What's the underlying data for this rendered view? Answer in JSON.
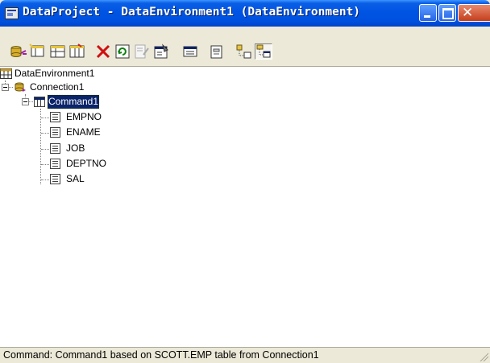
{
  "window": {
    "title": "DataProject - DataEnvironment1 (DataEnvironment)"
  },
  "toolbar": {
    "buttons": [
      {
        "name": "add-connection-button",
        "icon": "connection-icon"
      },
      {
        "name": "add-command-button",
        "icon": "command-icon"
      },
      {
        "name": "add-child-command-button",
        "icon": "child-command-icon"
      },
      {
        "name": "insert-stored-procedures-button",
        "icon": "stored-procedure-icon"
      },
      {
        "name": "delete-button",
        "icon": "delete-icon"
      },
      {
        "name": "refresh-button",
        "icon": "refresh-icon"
      },
      {
        "name": "view-code-button",
        "icon": "code-icon"
      },
      {
        "name": "properties-button",
        "icon": "properties-icon"
      },
      {
        "name": "options-button",
        "icon": "options-icon"
      },
      {
        "name": "design-button",
        "icon": "design-icon"
      },
      {
        "name": "arrange-by-connections-button",
        "icon": "arrange-connections-icon"
      },
      {
        "name": "arrange-by-objects-button",
        "icon": "arrange-objects-icon"
      }
    ]
  },
  "tree": {
    "root_label": "DataEnvironment1",
    "connection_label": "Connection1",
    "command_label": "Command1",
    "fields": [
      "EMPNO",
      "ENAME",
      "JOB",
      "DEPTNO",
      "SAL"
    ]
  },
  "status": {
    "text": "Command:  Command1 based on SCOTT.EMP  table  from Connection1"
  },
  "colors": {
    "titlebar": "#0054e3",
    "selection": "#0a246a",
    "close_button": "#c43e1c"
  }
}
